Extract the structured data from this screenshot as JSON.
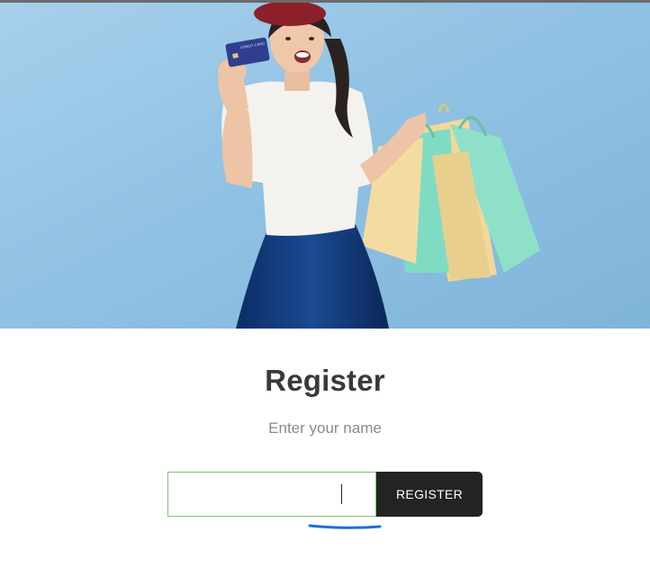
{
  "hero": {
    "card_label": "CREDIT CARD"
  },
  "register": {
    "title": "Register",
    "subtitle": "Enter your name",
    "name_value": "",
    "button_label": "REGISTER"
  },
  "colors": {
    "hero_background": "#8dc0e2",
    "input_border": "#7cc27a",
    "button_background": "#232323",
    "underline": "#1a6fd6"
  }
}
